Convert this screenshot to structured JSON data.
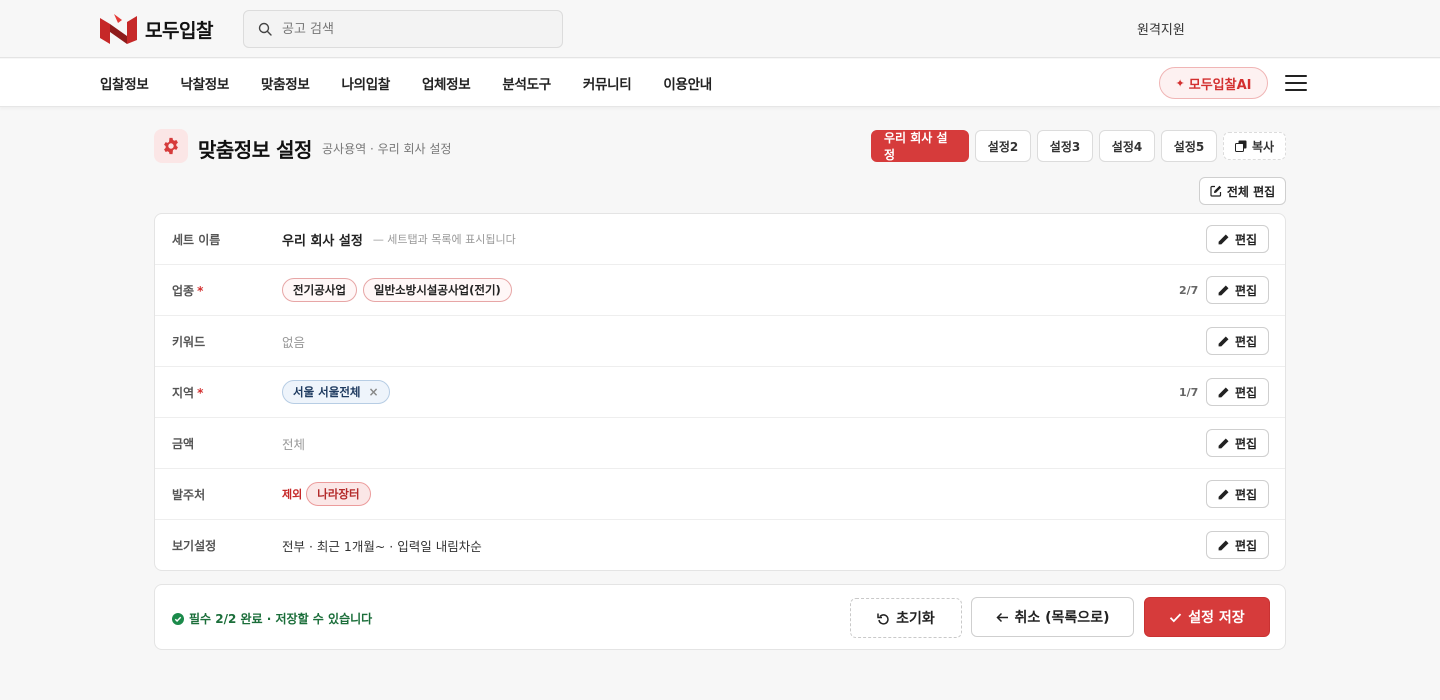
{
  "header": {
    "logo_text": "모두입찰",
    "search_placeholder": "공고 검색",
    "remote_support": "원격지원"
  },
  "nav": {
    "items": [
      "입찰정보",
      "낙찰정보",
      "맞춤정보",
      "나의입찰",
      "업체정보",
      "분석도구",
      "커뮤니티",
      "이용안내"
    ],
    "ai_button": "모두입찰AI",
    "ai_spark": "✦",
    "brand_color": "#d63b3b"
  },
  "page": {
    "title": "맞춤정보 설정",
    "breadcrumb": "공사용역 · 우리 회사 설정",
    "tabs": [
      "우리 회사 설정",
      "설정2",
      "설정3",
      "설정4",
      "설정5"
    ],
    "active_tab": "우리 회사 설정",
    "copy_label": "복사",
    "edit_all_label": "전체 편집"
  },
  "rows": {
    "edit_label": "편집",
    "name": {
      "label": "세트 이름",
      "value": "우리 회사 설정",
      "hint": "— 세트탭과 목록에 표시됩니다"
    },
    "industry": {
      "label": "업종",
      "required": "*",
      "chips": [
        "전기공사업",
        "일반소방시설공사업(전기)"
      ],
      "count": "2/7"
    },
    "keyword": {
      "label": "키워드",
      "value": "없음"
    },
    "region": {
      "label": "지역",
      "required": "*",
      "chips": [
        "서울 서울전체"
      ],
      "remove": "×",
      "count": "1/7"
    },
    "amount": {
      "label": "금액",
      "value": "전체"
    },
    "orderer": {
      "label": "발주처",
      "exclude": "제외",
      "chips": [
        "나라장터"
      ]
    },
    "view": {
      "label": "보기설정",
      "value": "전부 · 최근 1개월~ · 입력일 내림차순"
    }
  },
  "footer": {
    "status": "필수 2/2 완료 · 저장할 수 있습니다",
    "reset": "초기화",
    "cancel": "취소 (목록으로)",
    "save": "설정 저장"
  }
}
